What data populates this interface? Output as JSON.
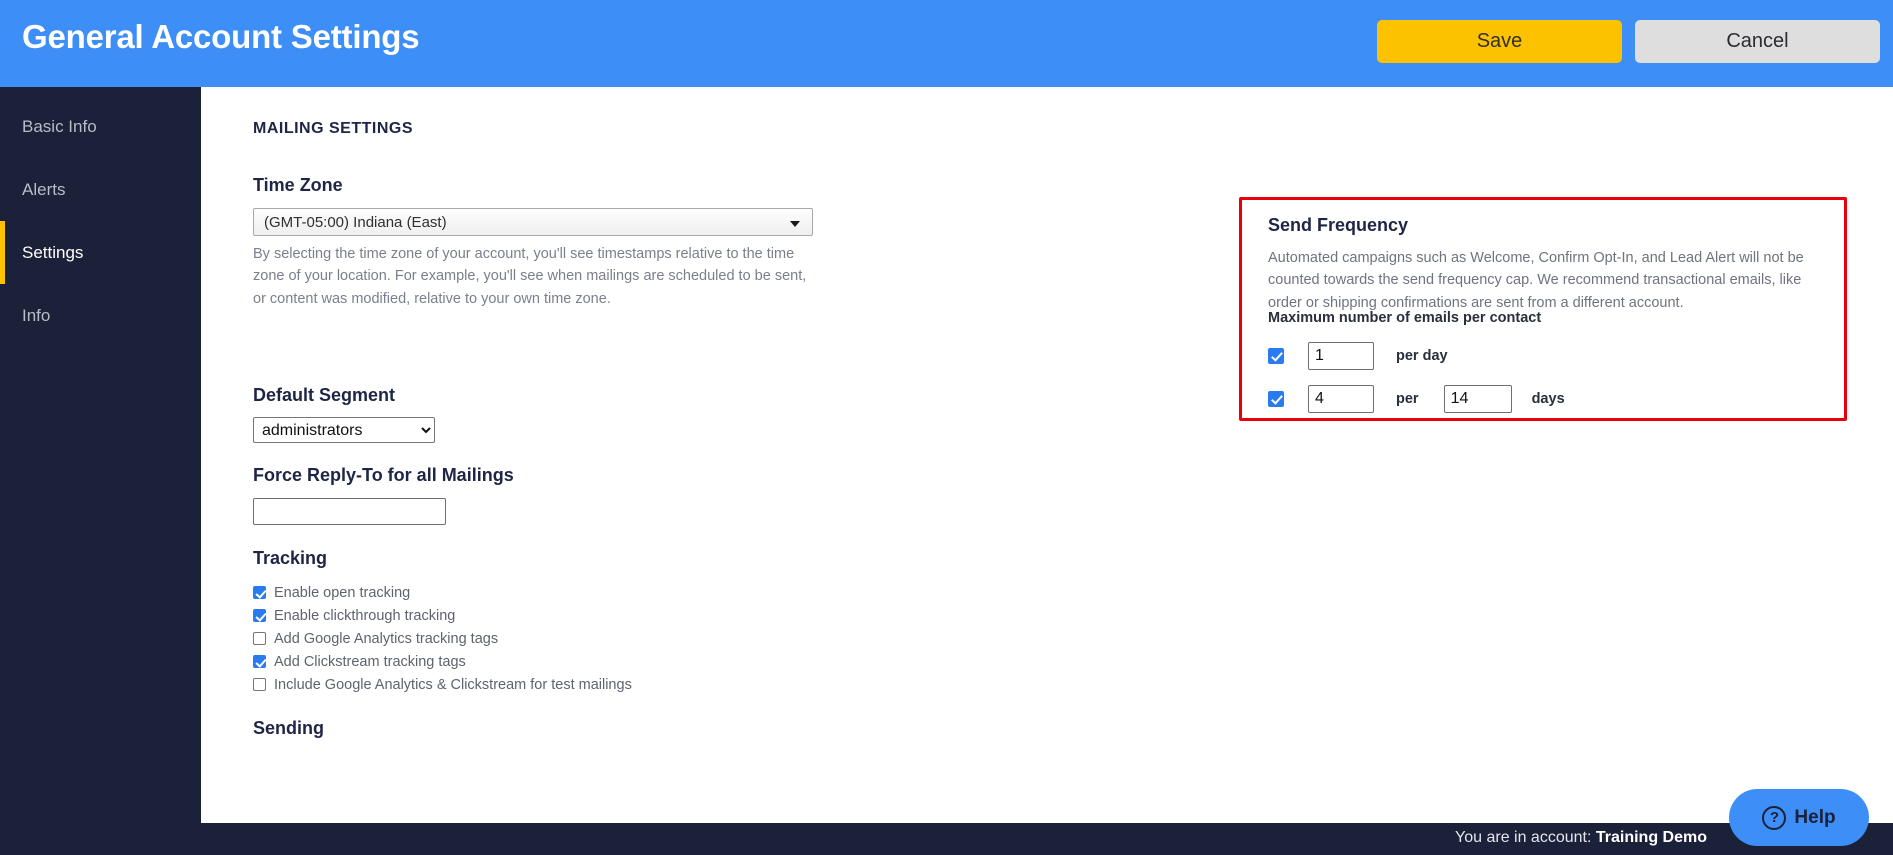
{
  "header": {
    "title": "General Account Settings",
    "save_label": "Save",
    "cancel_label": "Cancel",
    "background_color": "#3d8ef7",
    "save_color": "#fcc200",
    "cancel_color": "#dedede"
  },
  "sidebar": {
    "background_color": "#1b2139",
    "active_marker_color": "#fcc200",
    "items": [
      {
        "label": "Basic Info",
        "active": false
      },
      {
        "label": "Alerts",
        "active": false
      },
      {
        "label": "Settings",
        "active": true
      },
      {
        "label": "Info",
        "active": false
      }
    ]
  },
  "main": {
    "section_title": "MAILING SETTINGS",
    "time_zone": {
      "label": "Time Zone",
      "value": "(GMT-05:00) Indiana (East)",
      "help": "By selecting the time zone of your account, you'll see timestamps relative to the time zone of your location. For example, you'll see when mailings are scheduled to be sent, or content was modified, relative to your own time zone."
    },
    "default_segment": {
      "label": "Default Segment",
      "value": "administrators",
      "options": [
        "administrators"
      ]
    },
    "force_reply_to": {
      "label": "Force Reply-To for all Mailings",
      "value": "",
      "placeholder": ""
    },
    "tracking": {
      "label": "Tracking",
      "items": [
        {
          "label": "Enable open tracking",
          "checked": true
        },
        {
          "label": "Enable clickthrough tracking",
          "checked": true
        },
        {
          "label": "Add Google Analytics tracking tags",
          "checked": false
        },
        {
          "label": "Add Clickstream tracking tags",
          "checked": true
        },
        {
          "label": "Include Google Analytics & Clickstream for test mailings",
          "checked": false
        }
      ]
    },
    "sending": {
      "label": "Sending"
    }
  },
  "send_frequency": {
    "title": "Send Frequency",
    "description": "Automated campaigns such as Welcome, Confirm Opt-In, and Lead Alert will not be counted towards the send frequency cap. We recommend transactional emails, like order or shipping confirmations are sent from a different account.",
    "subtitle": "Maximum number of emails per contact",
    "highlight_color": "#e8000d",
    "row_per_day": {
      "checked": true,
      "count": "1",
      "unit": "per day"
    },
    "row_per_days": {
      "checked": true,
      "count": "4",
      "per_label": "per",
      "days": "14",
      "days_label": "days"
    }
  },
  "footer": {
    "prefix": "You are in account:",
    "account": "Training Demo",
    "background_color": "#1b2139",
    "help_label": "Help",
    "help_icon_glyph": "?"
  }
}
